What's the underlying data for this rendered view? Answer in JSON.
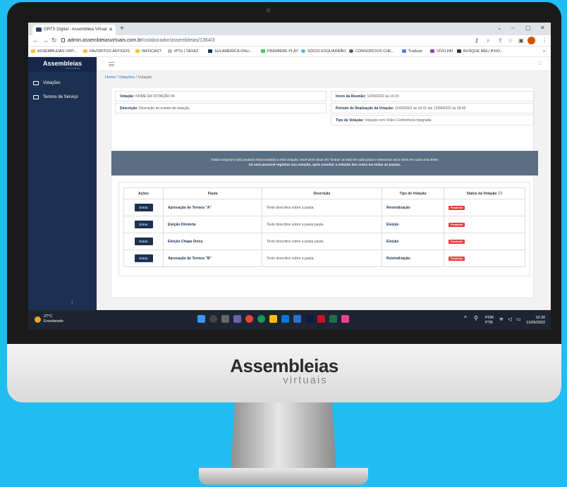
{
  "monitor": {
    "brand": "Assembleias",
    "brand_sub": "virtuais"
  },
  "browser": {
    "tab_title": "GRTS Digital - Assembleia Virtual",
    "url_host": "admin.assembleiasvirtuais.com.br",
    "url_path": "/colaborador/assembleias/1364/3",
    "bookmarks": [
      "ASSEMBLEIAS VIRT...",
      "FAVORITOS ANTIGOS",
      "INFOCAST",
      "IPTU | SEFAZ",
      "SULAMERICA ONLI...",
      "PREMIERE PLAY",
      "SÓCIO ESQUADRÃO",
      "CONSORCIOS CHE...",
      "Traduzir",
      "VIVO PAI",
      "BUSQUE MEU IPHO..."
    ]
  },
  "sidebar": {
    "brand": "Assembleias",
    "brand_sub": "virtuais",
    "items": [
      {
        "label": "Votações"
      },
      {
        "label": "Termos de Serviço"
      }
    ]
  },
  "breadcrumb": {
    "home": "Home",
    "sep": "/",
    "level1": "Votações",
    "current": "Votação"
  },
  "details": {
    "votacao_label": "Votação:",
    "votacao_value": "NOME DA VOTAÇÃO 04",
    "descricao_label": "Descrição:",
    "descricao_value": "Descrição do evento de votação.",
    "inicio_label": "Início da Reunião:",
    "inicio_value": "11/09/2022 às 16:15",
    "periodo_label": "Período de Realização da Votação:",
    "periodo_value": "11/09/2022 às 16:15 ate 12/09/2022 às 18:00",
    "tipo_label": "Tipo de Votação:",
    "tipo_value": "Votação com Vídeo Conferência Integrada"
  },
  "banner": {
    "line1": "Abaixo segue(m) a(s) pauta(s) relacionada(s) a esta votação. Você deve clicar em \"Entrar\" ao lado de cada pauta e selecionar seus votos em cada uma delas.",
    "line2": "Só será possível registrar sua votação, após concluir a seleção dos votos em todas as pautas."
  },
  "table": {
    "headers": [
      "Ações",
      "Pauta",
      "Descrição",
      "Tipo de Votação",
      "Status da Votação"
    ],
    "button_label": "Entrar",
    "rows": [
      {
        "pauta": "Aprovação de Termos \"A\"",
        "descricao": "Texto descritivo sobre a pauta.",
        "tipo": "Reivindicação",
        "status": "Pendente"
      },
      {
        "pauta": "Eleição Diretoria",
        "descricao": "Texto descritivo sobre a pauta pauta.",
        "tipo": "Eleição",
        "status": "Pendente"
      },
      {
        "pauta": "Eleição Chapa Única",
        "descricao": "Texto descritivo sobre a pauta pauta.",
        "tipo": "Eleição",
        "status": "Pendente"
      },
      {
        "pauta": "Aprovação de Termos \"B\"",
        "descricao": "Texto descritivo sobre a pauta.",
        "tipo": "Reivindicação",
        "status": "Pendente"
      }
    ]
  },
  "taskbar": {
    "temp": "27°C",
    "weather": "Ensolarado",
    "lang1": "POR",
    "lang2": "PTB",
    "time": "16:36",
    "date": "11/09/2022"
  },
  "colors": {
    "navy": "#1c3152",
    "banner": "#5b6f84",
    "pending": "#e53e3e",
    "background": "#21bdf0"
  }
}
